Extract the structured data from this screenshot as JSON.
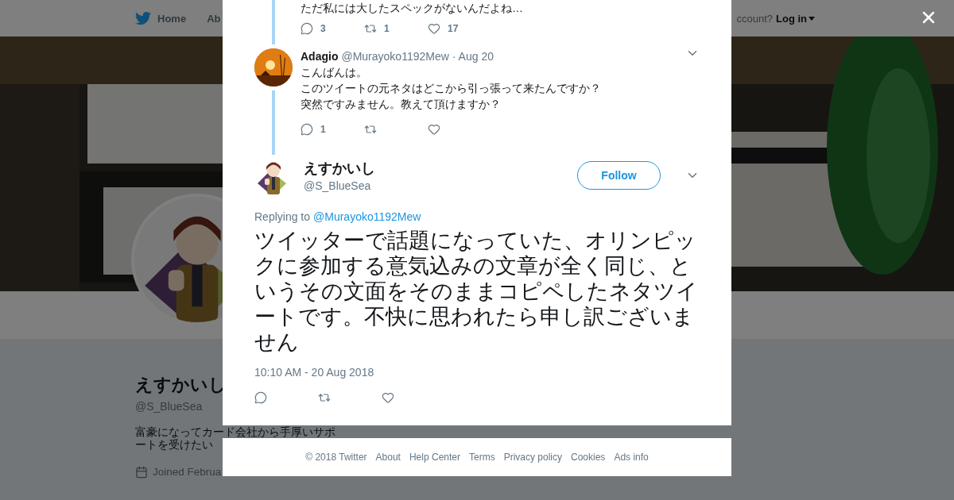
{
  "background_page": {
    "nav": {
      "items": [
        "Home",
        "Ab"
      ],
      "account_prompt": "ccount?",
      "login": "Log in"
    },
    "profile": {
      "name": "えすかいし",
      "handle": "@S_BlueSea",
      "bio": "富豪になってカード会社から手厚いサポートを受けたい",
      "joined": "Joined Februa"
    }
  },
  "thread": {
    "top_tweet": {
      "text": "ただ私には大したスペックがないんだよね…",
      "actions": [
        {
          "kind": "reply",
          "count": "3"
        },
        {
          "kind": "retweet",
          "count": "1"
        },
        {
          "kind": "like",
          "count": "17"
        }
      ]
    },
    "reply": {
      "name": "Adagio",
      "handle": "@Murayoko1192Mew",
      "date": "· Aug 20",
      "text_lines": [
        "こんばんは。",
        "このツイートの元ネタはどこから引っ張って来たんですか？",
        "突然ですみません。教えて頂けますか？"
      ],
      "actions": [
        {
          "kind": "reply",
          "count": "1"
        },
        {
          "kind": "retweet"
        },
        {
          "kind": "like"
        }
      ]
    }
  },
  "main_tweet": {
    "name": "えすかいし",
    "handle": "@S_BlueSea",
    "follow_button": "Follow",
    "replying_to": {
      "label": "Replying to",
      "handle": "@Murayoko1192Mew"
    },
    "text": "ツイッターで話題になっていた、オリンピックに参加する意気込みの文章が全く同じ、というその文面をそのままコピペしたネタツイートです。不快に思われたら申し訳ございません",
    "timestamp": "10:10 AM - 20 Aug 2018",
    "actions": [
      {
        "kind": "reply"
      },
      {
        "kind": "retweet"
      },
      {
        "kind": "like"
      }
    ]
  },
  "footer": [
    "© 2018 Twitter",
    "About",
    "Help Center",
    "Terms",
    "Privacy policy",
    "Cookies",
    "Ads info"
  ]
}
